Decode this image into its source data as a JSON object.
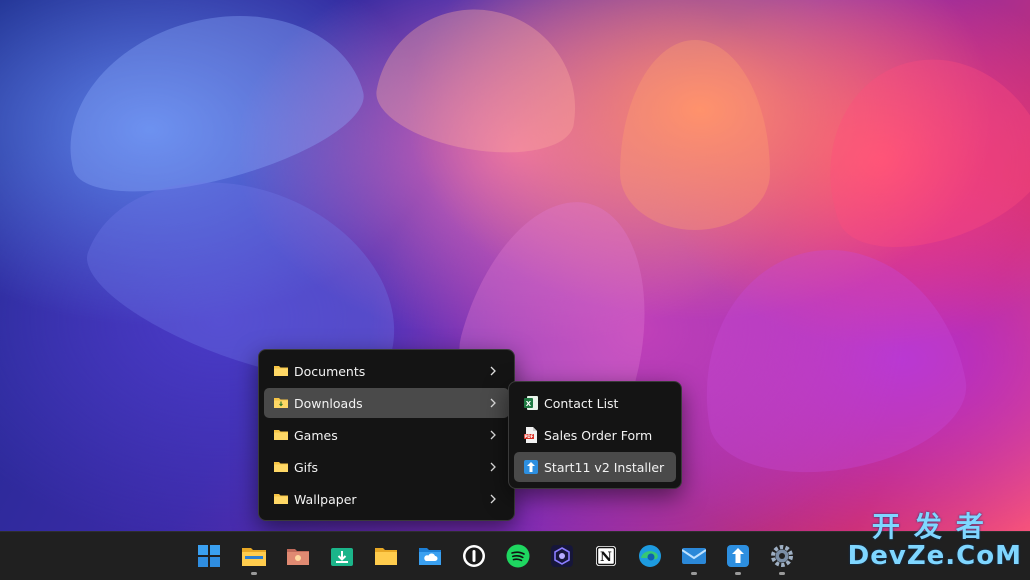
{
  "main_menu": {
    "items": [
      {
        "label": "Documents",
        "icon": "folder-icon",
        "has_submenu": true
      },
      {
        "label": "Downloads",
        "icon": "folder-download-icon",
        "has_submenu": true,
        "active": true
      },
      {
        "label": "Games",
        "icon": "folder-icon",
        "has_submenu": true
      },
      {
        "label": "Gifs",
        "icon": "folder-icon",
        "has_submenu": true
      },
      {
        "label": "Wallpaper",
        "icon": "folder-icon",
        "has_submenu": true
      }
    ]
  },
  "submenu": {
    "items": [
      {
        "label": "Contact List",
        "icon": "excel-file-icon"
      },
      {
        "label": "Sales Order Form",
        "icon": "pdf-file-icon"
      },
      {
        "label": "Start11 v2 Installer",
        "icon": "installer-icon",
        "active": true
      }
    ]
  },
  "taskbar": {
    "icons": [
      "windows-start-icon",
      "file-explorer-icon",
      "photos-folder-icon",
      "downloads-app-icon",
      "folder-icon",
      "cloud-folder-icon",
      "1password-icon",
      "spotify-icon",
      "app-icon",
      "notion-icon",
      "edge-icon",
      "mail-icon",
      "start11-icon",
      "settings-icon"
    ]
  },
  "watermark": {
    "line1": "开发者",
    "line2": "DevZe.CoM"
  },
  "colors": {
    "menu_bg": "#141414",
    "active_item": "#4a4a4a",
    "taskbar_bg": "#202020",
    "folder_yellow": "#f6c445"
  }
}
